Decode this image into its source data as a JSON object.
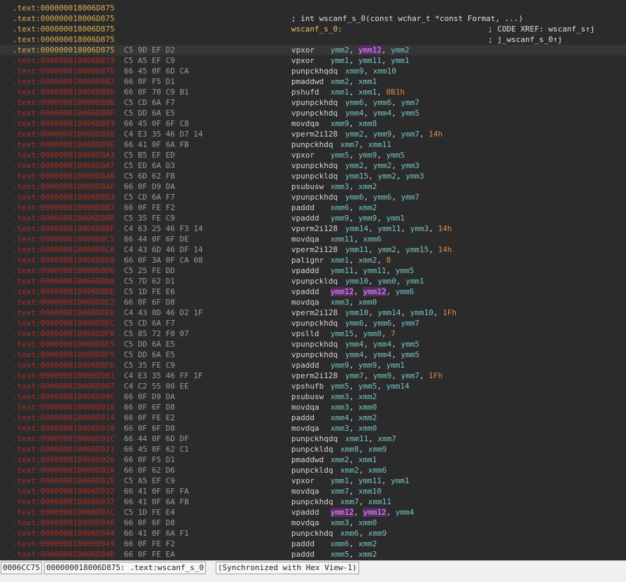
{
  "header_rows": [
    {
      "addr": ".text:000000018006D875",
      "type": "blank"
    },
    {
      "addr": ".text:000000018006D875",
      "type": "proto",
      "text": "; int wscanf_s_0(const wchar_t *const Format, ...)"
    },
    {
      "addr": ".text:000000018006D875",
      "type": "label",
      "label": "wscanf_s_0:",
      "xref": "; CODE XREF: wscanf_s↑j"
    },
    {
      "addr": ".text:000000018006D875",
      "type": "xref",
      "xref": "; j_wscanf_s_0↑j"
    }
  ],
  "instructions": [
    {
      "addr": ".text:000000018006D875",
      "bytes": "C5 9D EF D2",
      "mnem": "vpxor",
      "ops": [
        {
          "r": "ymm2"
        },
        {
          "t": ", "
        },
        {
          "r": "ymm12",
          "hl": true
        },
        {
          "t": ", "
        },
        {
          "r": "ymm2"
        }
      ]
    },
    {
      "addr": ".text:000000018006D879",
      "bytes": "C5 A5 EF C9",
      "mnem": "vpxor",
      "ops": [
        {
          "r": "ymm1"
        },
        {
          "t": ", "
        },
        {
          "r": "ymm11"
        },
        {
          "t": ", "
        },
        {
          "r": "ymm1"
        }
      ]
    },
    {
      "addr": ".text:000000018006D87D",
      "bytes": "66 45 0F 6D CA",
      "mnem": "punpckhqdq",
      "ops": [
        {
          "r": "xmm9"
        },
        {
          "t": ", "
        },
        {
          "r": "xmm10"
        }
      ]
    },
    {
      "addr": ".text:000000018006D882",
      "bytes": "66 0F F5 D1",
      "mnem": "pmaddwd",
      "ops": [
        {
          "r": "xmm2"
        },
        {
          "t": ", "
        },
        {
          "r": "xmm1"
        }
      ]
    },
    {
      "addr": ".text:000000018006D886",
      "bytes": "66 0F 70 C9 B1",
      "mnem": "pshufd",
      "ops": [
        {
          "r": "xmm1"
        },
        {
          "t": ", "
        },
        {
          "r": "xmm1"
        },
        {
          "t": ", "
        },
        {
          "i": "0B1h"
        }
      ]
    },
    {
      "addr": ".text:000000018006D88B",
      "bytes": "C5 CD 6A F7",
      "mnem": "vpunpckhdq",
      "ops": [
        {
          "r": "ymm6"
        },
        {
          "t": ", "
        },
        {
          "r": "ymm6"
        },
        {
          "t": ", "
        },
        {
          "r": "ymm7"
        }
      ]
    },
    {
      "addr": ".text:000000018006D88F",
      "bytes": "C5 DD 6A E5",
      "mnem": "vpunpckhdq",
      "ops": [
        {
          "r": "ymm4"
        },
        {
          "t": ", "
        },
        {
          "r": "ymm4"
        },
        {
          "t": ", "
        },
        {
          "r": "ymm5"
        }
      ]
    },
    {
      "addr": ".text:000000018006D893",
      "bytes": "66 45 0F 6F C8",
      "mnem": "movdqa",
      "ops": [
        {
          "r": "xmm9"
        },
        {
          "t": ", "
        },
        {
          "r": "xmm8"
        }
      ]
    },
    {
      "addr": ".text:000000018006D898",
      "bytes": "C4 E3 35 46 D7 14",
      "mnem": "vperm2i128",
      "ops": [
        {
          "r": "ymm2"
        },
        {
          "t": ", "
        },
        {
          "r": "ymm9"
        },
        {
          "t": ", "
        },
        {
          "r": "ymm7"
        },
        {
          "t": ", "
        },
        {
          "i": "14h"
        }
      ]
    },
    {
      "addr": ".text:000000018006D89E",
      "bytes": "66 41 0F 6A FB",
      "mnem": "punpckhdq",
      "ops": [
        {
          "r": "xmm7"
        },
        {
          "t": ", "
        },
        {
          "r": "xmm11"
        }
      ]
    },
    {
      "addr": ".text:000000018006D8A3",
      "bytes": "C5 B5 EF ED",
      "mnem": "vpxor",
      "ops": [
        {
          "r": "ymm5"
        },
        {
          "t": ", "
        },
        {
          "r": "ymm9"
        },
        {
          "t": ", "
        },
        {
          "r": "ymm5"
        }
      ]
    },
    {
      "addr": ".text:000000018006D8A7",
      "bytes": "C5 ED 6A D3",
      "mnem": "vpunpckhdq",
      "ops": [
        {
          "r": "ymm2"
        },
        {
          "t": ", "
        },
        {
          "r": "ymm2"
        },
        {
          "t": ", "
        },
        {
          "r": "ymm3"
        }
      ]
    },
    {
      "addr": ".text:000000018006D8AB",
      "bytes": "C5 6D 62 FB",
      "mnem": "vpunpckldq",
      "ops": [
        {
          "r": "ymm15"
        },
        {
          "t": ", "
        },
        {
          "r": "ymm2"
        },
        {
          "t": ", "
        },
        {
          "r": "ymm3"
        }
      ]
    },
    {
      "addr": ".text:000000018006D8AF",
      "bytes": "66 0F D9 DA",
      "mnem": "psubusw",
      "ops": [
        {
          "r": "xmm3"
        },
        {
          "t": ", "
        },
        {
          "r": "xmm2"
        }
      ]
    },
    {
      "addr": ".text:000000018006D8B3",
      "bytes": "C5 CD 6A F7",
      "mnem": "vpunpckhdq",
      "ops": [
        {
          "r": "ymm6"
        },
        {
          "t": ", "
        },
        {
          "r": "ymm6"
        },
        {
          "t": ", "
        },
        {
          "r": "ymm7"
        }
      ]
    },
    {
      "addr": ".text:000000018006D8B7",
      "bytes": "66 0F FE F2",
      "mnem": "paddd",
      "ops": [
        {
          "r": "xmm6"
        },
        {
          "t": ", "
        },
        {
          "r": "xmm2"
        }
      ]
    },
    {
      "addr": ".text:000000018006D8BB",
      "bytes": "C5 35 FE C9",
      "mnem": "vpaddd",
      "ops": [
        {
          "r": "ymm9"
        },
        {
          "t": ", "
        },
        {
          "r": "ymm9"
        },
        {
          "t": ", "
        },
        {
          "r": "ymm1"
        }
      ]
    },
    {
      "addr": ".text:000000018006D8BF",
      "bytes": "C4 63 25 46 F3 14",
      "mnem": "vperm2i128",
      "ops": [
        {
          "r": "ymm14"
        },
        {
          "t": ", "
        },
        {
          "r": "ymm11"
        },
        {
          "t": ", "
        },
        {
          "r": "ymm3"
        },
        {
          "t": ", "
        },
        {
          "i": "14h"
        }
      ]
    },
    {
      "addr": ".text:000000018006D8C5",
      "bytes": "66 44 0F 6F DE",
      "mnem": "movdqa",
      "ops": [
        {
          "r": "xmm11"
        },
        {
          "t": ", "
        },
        {
          "r": "xmm6"
        }
      ]
    },
    {
      "addr": ".text:000000018006D8CA",
      "bytes": "C4 43 6D 46 DF 14",
      "mnem": "vperm2i128",
      "ops": [
        {
          "r": "ymm11"
        },
        {
          "t": ", "
        },
        {
          "r": "ymm2"
        },
        {
          "t": ", "
        },
        {
          "r": "ymm15"
        },
        {
          "t": ", "
        },
        {
          "i": "14h"
        }
      ]
    },
    {
      "addr": ".text:000000018006D8D0",
      "bytes": "66 0F 3A 0F CA 08",
      "mnem": "palignr",
      "ops": [
        {
          "r": "xmm1"
        },
        {
          "t": ", "
        },
        {
          "r": "xmm2"
        },
        {
          "t": ", "
        },
        {
          "i": "8"
        }
      ]
    },
    {
      "addr": ".text:000000018006D8D6",
      "bytes": "C5 25 FE DD",
      "mnem": "vpaddd",
      "ops": [
        {
          "r": "ymm11"
        },
        {
          "t": ", "
        },
        {
          "r": "ymm11"
        },
        {
          "t": ", "
        },
        {
          "r": "ymm5"
        }
      ]
    },
    {
      "addr": ".text:000000018006D8DA",
      "bytes": "C5 7D 62 D1",
      "mnem": "vpunpckldq",
      "ops": [
        {
          "r": "ymm10"
        },
        {
          "t": ", "
        },
        {
          "r": "ymm0"
        },
        {
          "t": ", "
        },
        {
          "r": "ymm1"
        }
      ]
    },
    {
      "addr": ".text:000000018006D8DE",
      "bytes": "C5 1D FE E6",
      "mnem": "vpaddd",
      "ops": [
        {
          "r": "ymm12",
          "hl": true
        },
        {
          "t": ", "
        },
        {
          "r": "ymm12",
          "hl": true
        },
        {
          "t": ", "
        },
        {
          "r": "ymm6"
        }
      ]
    },
    {
      "addr": ".text:000000018006D8E2",
      "bytes": "66 0F 6F D8",
      "mnem": "movdqa",
      "ops": [
        {
          "r": "xmm3"
        },
        {
          "t": ", "
        },
        {
          "r": "xmm0"
        }
      ]
    },
    {
      "addr": ".text:000000018006D8E6",
      "bytes": "C4 43 0D 46 D2 1F",
      "mnem": "vperm2i128",
      "ops": [
        {
          "r": "ymm10"
        },
        {
          "t": ", "
        },
        {
          "r": "ymm14"
        },
        {
          "t": ", "
        },
        {
          "r": "ymm10"
        },
        {
          "t": ", "
        },
        {
          "i": "1Fh"
        }
      ]
    },
    {
      "addr": ".text:000000018006D8EC",
      "bytes": "C5 CD 6A F7",
      "mnem": "vpunpckhdq",
      "ops": [
        {
          "r": "ymm6"
        },
        {
          "t": ", "
        },
        {
          "r": "ymm6"
        },
        {
          "t": ", "
        },
        {
          "r": "ymm7"
        }
      ]
    },
    {
      "addr": ".text:000000018006D8F0",
      "bytes": "C5 85 72 F0 07",
      "mnem": "vpslld",
      "ops": [
        {
          "r": "ymm15"
        },
        {
          "t": ", "
        },
        {
          "r": "ymm0"
        },
        {
          "t": ", "
        },
        {
          "i": "7"
        }
      ]
    },
    {
      "addr": ".text:000000018006D8F5",
      "bytes": "C5 DD 6A E5",
      "mnem": "vpunpckhdq",
      "ops": [
        {
          "r": "ymm4"
        },
        {
          "t": ", "
        },
        {
          "r": "ymm4"
        },
        {
          "t": ", "
        },
        {
          "r": "ymm5"
        }
      ]
    },
    {
      "addr": ".text:000000018006D8F9",
      "bytes": "C5 DD 6A E5",
      "mnem": "vpunpckhdq",
      "ops": [
        {
          "r": "ymm4"
        },
        {
          "t": ", "
        },
        {
          "r": "ymm4"
        },
        {
          "t": ", "
        },
        {
          "r": "ymm5"
        }
      ]
    },
    {
      "addr": ".text:000000018006D8FD",
      "bytes": "C5 35 FE C9",
      "mnem": "vpaddd",
      "ops": [
        {
          "r": "ymm9"
        },
        {
          "t": ", "
        },
        {
          "r": "ymm9"
        },
        {
          "t": ", "
        },
        {
          "r": "ymm1"
        }
      ]
    },
    {
      "addr": ".text:000000018006D901",
      "bytes": "C4 E3 35 46 FF 1F",
      "mnem": "vperm2i128",
      "ops": [
        {
          "r": "ymm7"
        },
        {
          "t": ", "
        },
        {
          "r": "ymm9"
        },
        {
          "t": ", "
        },
        {
          "r": "ymm7"
        },
        {
          "t": ", "
        },
        {
          "i": "1Fh"
        }
      ]
    },
    {
      "addr": ".text:000000018006D907",
      "bytes": "C4 C2 55 00 EE",
      "mnem": "vpshufb",
      "ops": [
        {
          "r": "ymm5"
        },
        {
          "t": ", "
        },
        {
          "r": "ymm5"
        },
        {
          "t": ", "
        },
        {
          "r": "ymm14"
        }
      ]
    },
    {
      "addr": ".text:000000018006D90C",
      "bytes": "66 0F D9 DA",
      "mnem": "psubusw",
      "ops": [
        {
          "r": "xmm3"
        },
        {
          "t": ", "
        },
        {
          "r": "xmm2"
        }
      ]
    },
    {
      "addr": ".text:000000018006D910",
      "bytes": "66 0F 6F D8",
      "mnem": "movdqa",
      "ops": [
        {
          "r": "xmm3"
        },
        {
          "t": ", "
        },
        {
          "r": "xmm0"
        }
      ]
    },
    {
      "addr": ".text:000000018006D914",
      "bytes": "66 0F FE E2",
      "mnem": "paddd",
      "ops": [
        {
          "r": "xmm4"
        },
        {
          "t": ", "
        },
        {
          "r": "xmm2"
        }
      ]
    },
    {
      "addr": ".text:000000018006D918",
      "bytes": "66 0F 6F D8",
      "mnem": "movdqa",
      "ops": [
        {
          "r": "xmm3"
        },
        {
          "t": ", "
        },
        {
          "r": "xmm0"
        }
      ]
    },
    {
      "addr": ".text:000000018006D91C",
      "bytes": "66 44 0F 6D DF",
      "mnem": "punpckhqdq",
      "ops": [
        {
          "r": "xmm11"
        },
        {
          "t": ", "
        },
        {
          "r": "xmm7"
        }
      ]
    },
    {
      "addr": ".text:000000018006D921",
      "bytes": "66 45 0F 62 C1",
      "mnem": "punpckldq",
      "ops": [
        {
          "r": "xmm8"
        },
        {
          "t": ", "
        },
        {
          "r": "xmm9"
        }
      ]
    },
    {
      "addr": ".text:000000018006D926",
      "bytes": "66 0F F5 D1",
      "mnem": "pmaddwd",
      "ops": [
        {
          "r": "xmm2"
        },
        {
          "t": ", "
        },
        {
          "r": "xmm1"
        }
      ]
    },
    {
      "addr": ".text:000000018006D92A",
      "bytes": "66 0F 62 D6",
      "mnem": "punpckldq",
      "ops": [
        {
          "r": "xmm2"
        },
        {
          "t": ", "
        },
        {
          "r": "xmm6"
        }
      ]
    },
    {
      "addr": ".text:000000018006D92E",
      "bytes": "C5 A5 EF C9",
      "mnem": "vpxor",
      "ops": [
        {
          "r": "ymm1"
        },
        {
          "t": ", "
        },
        {
          "r": "ymm11"
        },
        {
          "t": ", "
        },
        {
          "r": "ymm1"
        }
      ]
    },
    {
      "addr": ".text:000000018006D932",
      "bytes": "66 41 0F 6F FA",
      "mnem": "movdqa",
      "ops": [
        {
          "r": "xmm7"
        },
        {
          "t": ", "
        },
        {
          "r": "xmm10"
        }
      ]
    },
    {
      "addr": ".text:000000018006D937",
      "bytes": "66 41 0F 6A FB",
      "mnem": "punpckhdq",
      "ops": [
        {
          "r": "xmm7"
        },
        {
          "t": ", "
        },
        {
          "r": "xmm11"
        }
      ]
    },
    {
      "addr": ".text:000000018006D93C",
      "bytes": "C5 1D FE E4",
      "mnem": "vpaddd",
      "ops": [
        {
          "r": "ymm12",
          "hl": true
        },
        {
          "t": ", "
        },
        {
          "r": "ymm12",
          "hl": true
        },
        {
          "t": ", "
        },
        {
          "r": "ymm4"
        }
      ]
    },
    {
      "addr": ".text:000000018006D940",
      "bytes": "66 0F 6F D8",
      "mnem": "movdqa",
      "ops": [
        {
          "r": "xmm3"
        },
        {
          "t": ", "
        },
        {
          "r": "xmm0"
        }
      ]
    },
    {
      "addr": ".text:000000018006D944",
      "bytes": "66 41 0F 6A F1",
      "mnem": "punpckhdq",
      "ops": [
        {
          "r": "xmm6"
        },
        {
          "t": ", "
        },
        {
          "r": "xmm9"
        }
      ]
    },
    {
      "addr": ".text:000000018006D949",
      "bytes": "66 0F FE F2",
      "mnem": "paddd",
      "ops": [
        {
          "r": "xmm6"
        },
        {
          "t": ", "
        },
        {
          "r": "xmm2"
        }
      ]
    },
    {
      "addr": ".text:000000018006D94D",
      "bytes": "66 0F FE EA",
      "mnem": "paddd",
      "ops": [
        {
          "r": "xmm5"
        },
        {
          "t": ", "
        },
        {
          "r": "xmm2"
        }
      ]
    }
  ],
  "statusbar": {
    "offset": "0006CC75",
    "location": "000000018006D875: .text:wscanf_s_0",
    "sync": "(Synchronized with Hex View-1)"
  }
}
